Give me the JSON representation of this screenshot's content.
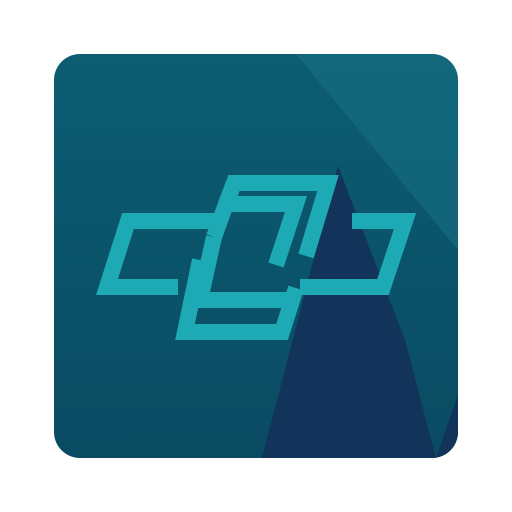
{
  "icon": {
    "semantic": "interlocking-rhombus-logo-icon",
    "colors": {
      "background_top": "#0c5d72",
      "background_bottom": "#094b62",
      "shadow_dark": "#13345a",
      "highlight_light": "#1a7184",
      "logo_teal": "#1eaab5"
    }
  }
}
